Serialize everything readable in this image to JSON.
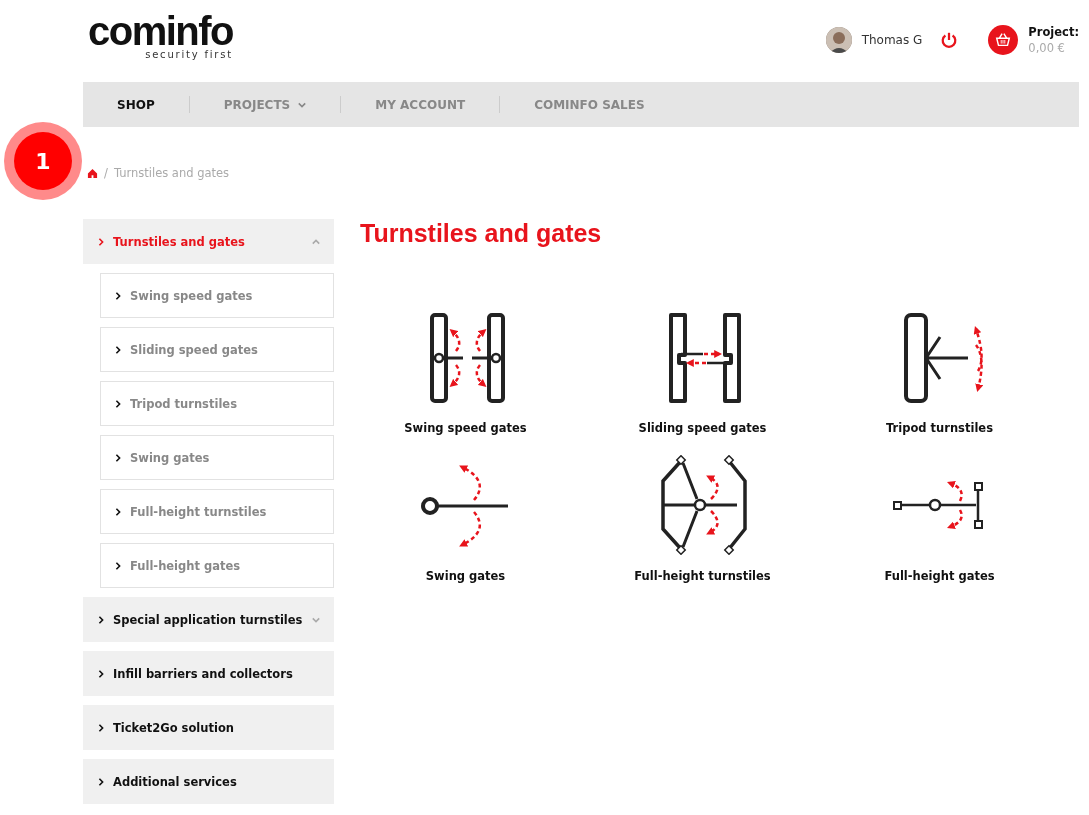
{
  "logo": {
    "name": "cominfo",
    "tagline": "security first"
  },
  "user": {
    "name": "Thomas G"
  },
  "cart": {
    "label": "Project:",
    "amount": "0,00 €"
  },
  "nav": [
    {
      "label": "SHOP",
      "selected": true,
      "kind": "link"
    },
    {
      "label": "PROJECTS",
      "selected": false,
      "kind": "menu"
    },
    {
      "label": "MY ACCOUNT",
      "selected": false,
      "kind": "link"
    },
    {
      "label": "COMINFO SALES",
      "selected": false,
      "kind": "link"
    }
  ],
  "annotation": {
    "label": "1"
  },
  "breadcrumb": [
    {
      "separator": "/",
      "label": "Turnstiles and gates"
    }
  ],
  "sidebar": [
    {
      "label": "Turnstiles and gates",
      "selected": true,
      "kind": "group",
      "expanded": true,
      "children": [
        {
          "label": "Swing speed gates"
        },
        {
          "label": "Sliding speed gates"
        },
        {
          "label": "Tripod turnstiles"
        },
        {
          "label": "Swing gates"
        },
        {
          "label": "Full-height turnstiles"
        },
        {
          "label": "Full-height gates"
        }
      ]
    },
    {
      "label": "Special application turnstiles",
      "selected": false,
      "kind": "group",
      "expanded": false
    },
    {
      "label": "Infill barriers and collectors",
      "selected": false,
      "kind": "link"
    },
    {
      "label": "Ticket2Go solution",
      "selected": false,
      "kind": "link"
    },
    {
      "label": "Additional services",
      "selected": false,
      "kind": "link"
    }
  ],
  "title": "Turnstiles and gates",
  "products": [
    {
      "label": "Swing speed gates",
      "kind": "swing-speed"
    },
    {
      "label": "Sliding speed gates",
      "kind": "sliding-speed"
    },
    {
      "label": "Tripod turnstiles",
      "kind": "tripod"
    },
    {
      "label": "Swing gates",
      "kind": "swing"
    },
    {
      "label": "Full-height turnstiles",
      "kind": "full-turnstile"
    },
    {
      "label": "Full-height gates",
      "kind": "full-gate"
    }
  ]
}
